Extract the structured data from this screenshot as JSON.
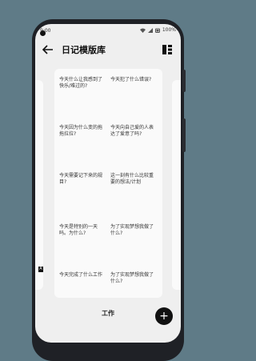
{
  "status_bar": {
    "time": "9:00",
    "battery": "100%"
  },
  "app_bar": {
    "title": "日记模版库"
  },
  "prompts_main": [
    "今天什么让我感到了快乐/难过的?",
    "今天犯了什么错误?",
    "今天因为什么变的拖拖拉拉?",
    "今天向自己爱的人表达了爱意了吗?",
    "今天需要记下来的规目?",
    "这一刻有什么比较重要的想法/计划",
    "今天是特别的一天吗。为什么?",
    "为了实现梦想我做了什么?",
    "今天完成了什么工作",
    "为了实现梦想我做了什么?"
  ],
  "page_label": "工作",
  "side_letter": "A",
  "fab_label": "+"
}
